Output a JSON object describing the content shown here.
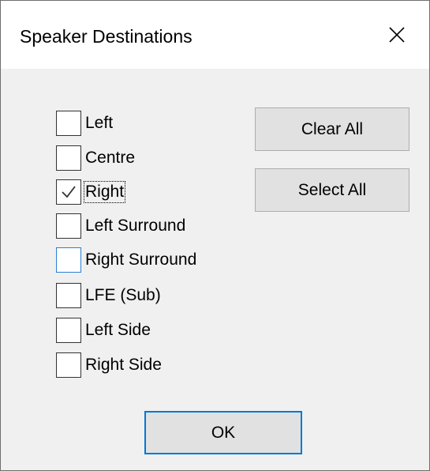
{
  "window": {
    "title": "Speaker Destinations",
    "close_icon": "close-icon"
  },
  "checkboxes": [
    {
      "label": "Left",
      "checked": false
    },
    {
      "label": "Centre",
      "checked": false
    },
    {
      "label": "Right",
      "checked": true,
      "focused": true
    },
    {
      "label": "Left Surround",
      "checked": false
    },
    {
      "label": "Right Surround",
      "checked": false,
      "hovered": true
    },
    {
      "label": "LFE (Sub)",
      "checked": false
    },
    {
      "label": "Left Side",
      "checked": false
    },
    {
      "label": "Right Side",
      "checked": false
    }
  ],
  "buttons": {
    "clear_all": "Clear All",
    "select_all": "Select All",
    "ok": "OK"
  },
  "colors": {
    "dialog_bg": "#f0f0f0",
    "titlebar_bg": "#ffffff",
    "button_bg": "#e1e1e1",
    "default_button_border": "#0078d7",
    "hover_checkbox_border": "#2a7fd4"
  }
}
